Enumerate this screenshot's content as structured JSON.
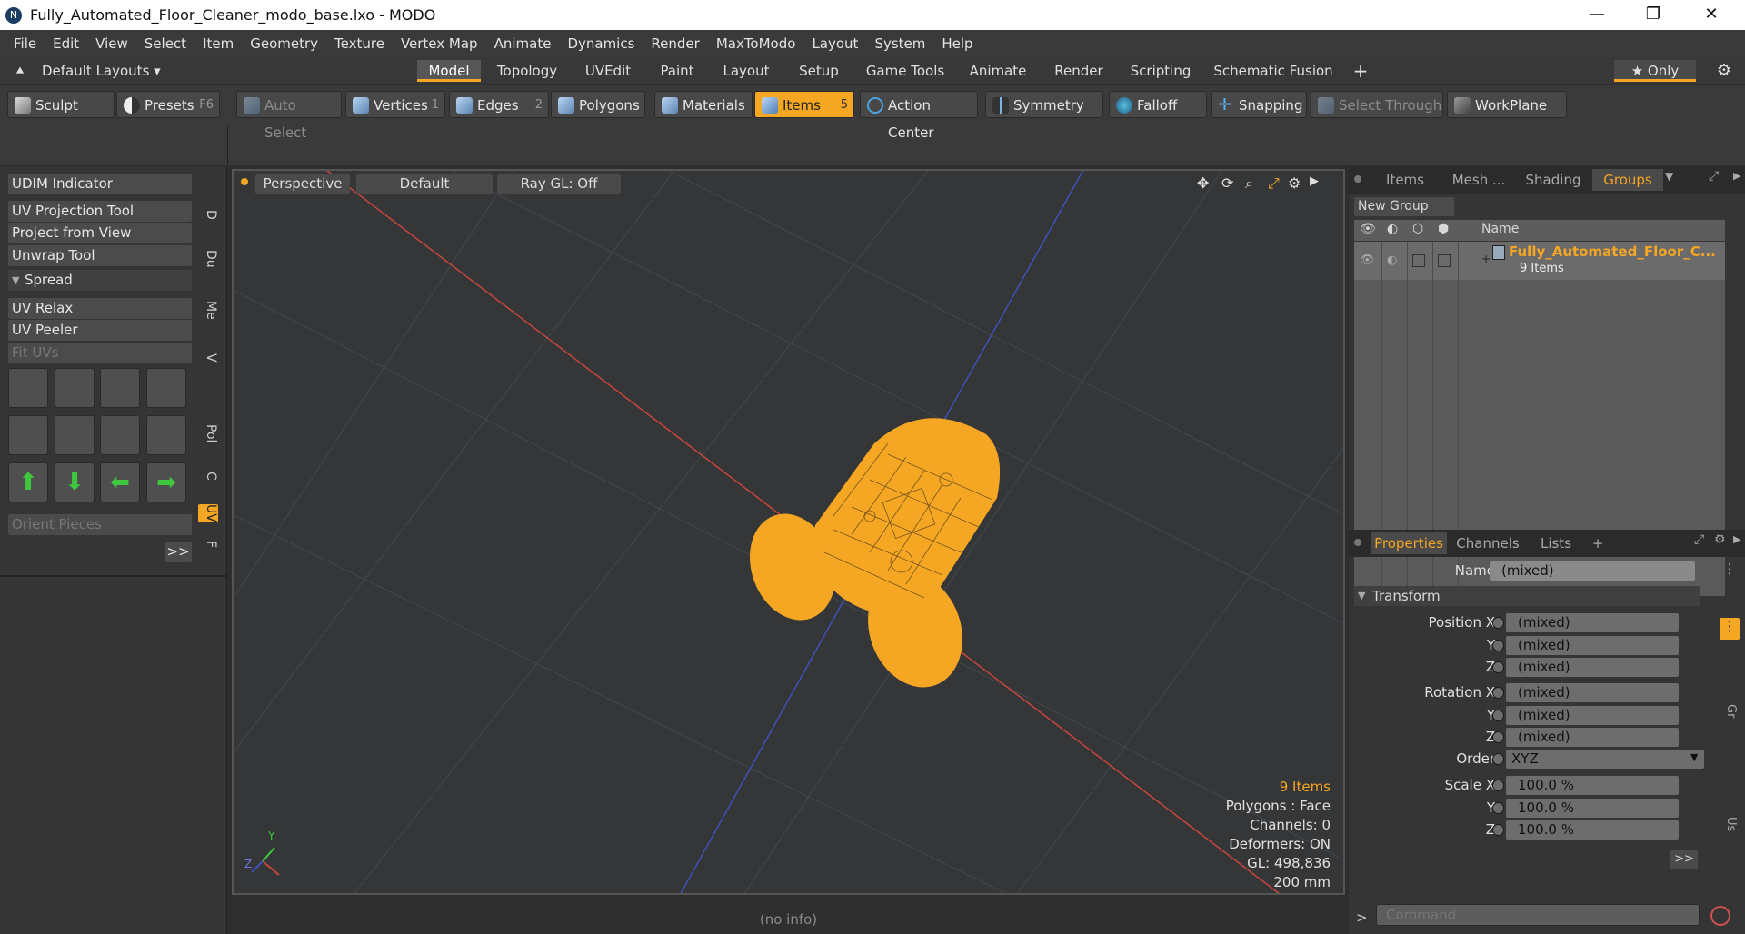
{
  "window": {
    "title": "Fully_Automated_Floor_Cleaner_modo_base.lxo - MODO",
    "logo": "N",
    "minimize": "—",
    "maximize": "❐",
    "close": "✕"
  },
  "menu": [
    "File",
    "Edit",
    "View",
    "Select",
    "Item",
    "Geometry",
    "Texture",
    "Vertex Map",
    "Animate",
    "Dynamics",
    "Render",
    "MaxToModo",
    "Layout",
    "System",
    "Help"
  ],
  "layoutbar": {
    "layouts_label": "Default Layouts ▾",
    "tabs": [
      "Model",
      "Topology",
      "UVEdit",
      "Paint",
      "Layout",
      "Setup",
      "Game Tools",
      "Animate",
      "Render",
      "Scripting",
      "Schematic Fusion"
    ],
    "active_tab": "Model",
    "add": "+",
    "only_label": "★  Only"
  },
  "toolbar": {
    "sculpt": "Sculpt",
    "presets": "Presets",
    "presets_key": "F6",
    "auto_select": "Auto Select",
    "vertices": "Vertices",
    "vertices_num": "1",
    "edges": "Edges",
    "edges_num": "2",
    "polygons": "Polygons",
    "materials": "Materials",
    "items": "Items",
    "items_num": "5",
    "action_center": "Action Center",
    "symmetry": "Symmetry",
    "falloff": "Falloff",
    "snapping": "Snapping",
    "select_through": "Select Through",
    "workplane": "WorkPlane"
  },
  "leftpanel": {
    "buttons": [
      "UDIM Indicator",
      "UV Projection Tool",
      "Project from View",
      "Unwrap Tool"
    ],
    "spread": "Spread",
    "buttons2": [
      "UV Relax",
      "UV Peeler"
    ],
    "fit_uvs": "Fit UVs",
    "orient": "Orient Pieces",
    "more": ">>",
    "vtabs": [
      "D",
      "Du",
      "Me",
      "V",
      "Pol",
      "C",
      "UV",
      "F"
    ]
  },
  "viewport": {
    "view": "Perspective",
    "style": "Default",
    "raygl": "Ray GL: Off",
    "info": {
      "items": "9 Items",
      "polygons": "Polygons : Face",
      "channels": "Channels: 0",
      "deformers": "Deformers: ON",
      "gl": "GL: 498,836",
      "scale": "200 mm"
    },
    "axis_y": "Y",
    "axis_z": "Z"
  },
  "status": "(no info)",
  "groups": {
    "tabs": [
      "Items",
      "Mesh ...",
      "Shading",
      "Groups"
    ],
    "active": "Groups",
    "new_group": "New Group",
    "col_name": "Name",
    "item_name": "Fully_Automated_Floor_C...",
    "item_count": "9 Items"
  },
  "properties": {
    "tabs": [
      "Properties",
      "Channels",
      "Lists"
    ],
    "add": "+",
    "name_label": "Name",
    "name_value": "(mixed)",
    "transform": "Transform",
    "position": {
      "label_x": "Position X",
      "y": "Y",
      "z": "Z",
      "vx": "(mixed)",
      "vy": "(mixed)",
      "vz": "(mixed)"
    },
    "rotation": {
      "label_x": "Rotation X",
      "y": "Y",
      "z": "Z",
      "vx": "(mixed)",
      "vy": "(mixed)",
      "vz": "(mixed)"
    },
    "order_label": "Order",
    "order_value": "XYZ",
    "scale": {
      "label_x": "Scale X",
      "y": "Y",
      "z": "Z",
      "vx": "100.0 %",
      "vy": "100.0 %",
      "vz": "100.0 %"
    },
    "more": ">>",
    "side_tabs": [
      "Gr",
      "Us"
    ]
  },
  "command": {
    "prompt": ">",
    "placeholder": "Command"
  },
  "colors": {
    "accent": "#f5a623",
    "mesh": "#f5a623",
    "x_axis": "#c8463c",
    "z_axis": "#3e52b8"
  }
}
